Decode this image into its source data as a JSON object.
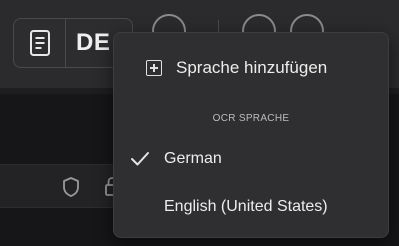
{
  "toolbar": {
    "language_code": "DE"
  },
  "menu": {
    "add_language_label": "Sprache hinzufügen",
    "section_header": "OCR SPRACHE",
    "languages": [
      {
        "label": "German",
        "selected": true
      },
      {
        "label": "English (United States)",
        "selected": false
      }
    ]
  },
  "icons": {
    "document": "document-icon",
    "add": "plus-square-icon",
    "check": "checkmark-icon",
    "shield": "shield-icon",
    "lock": "lock-icon"
  },
  "colors": {
    "background": "#1b1b1d",
    "toolbar": "#2b2b2d",
    "popup": "#2f2f31",
    "text": "#ededed",
    "muted_text": "#bcbcbc"
  }
}
